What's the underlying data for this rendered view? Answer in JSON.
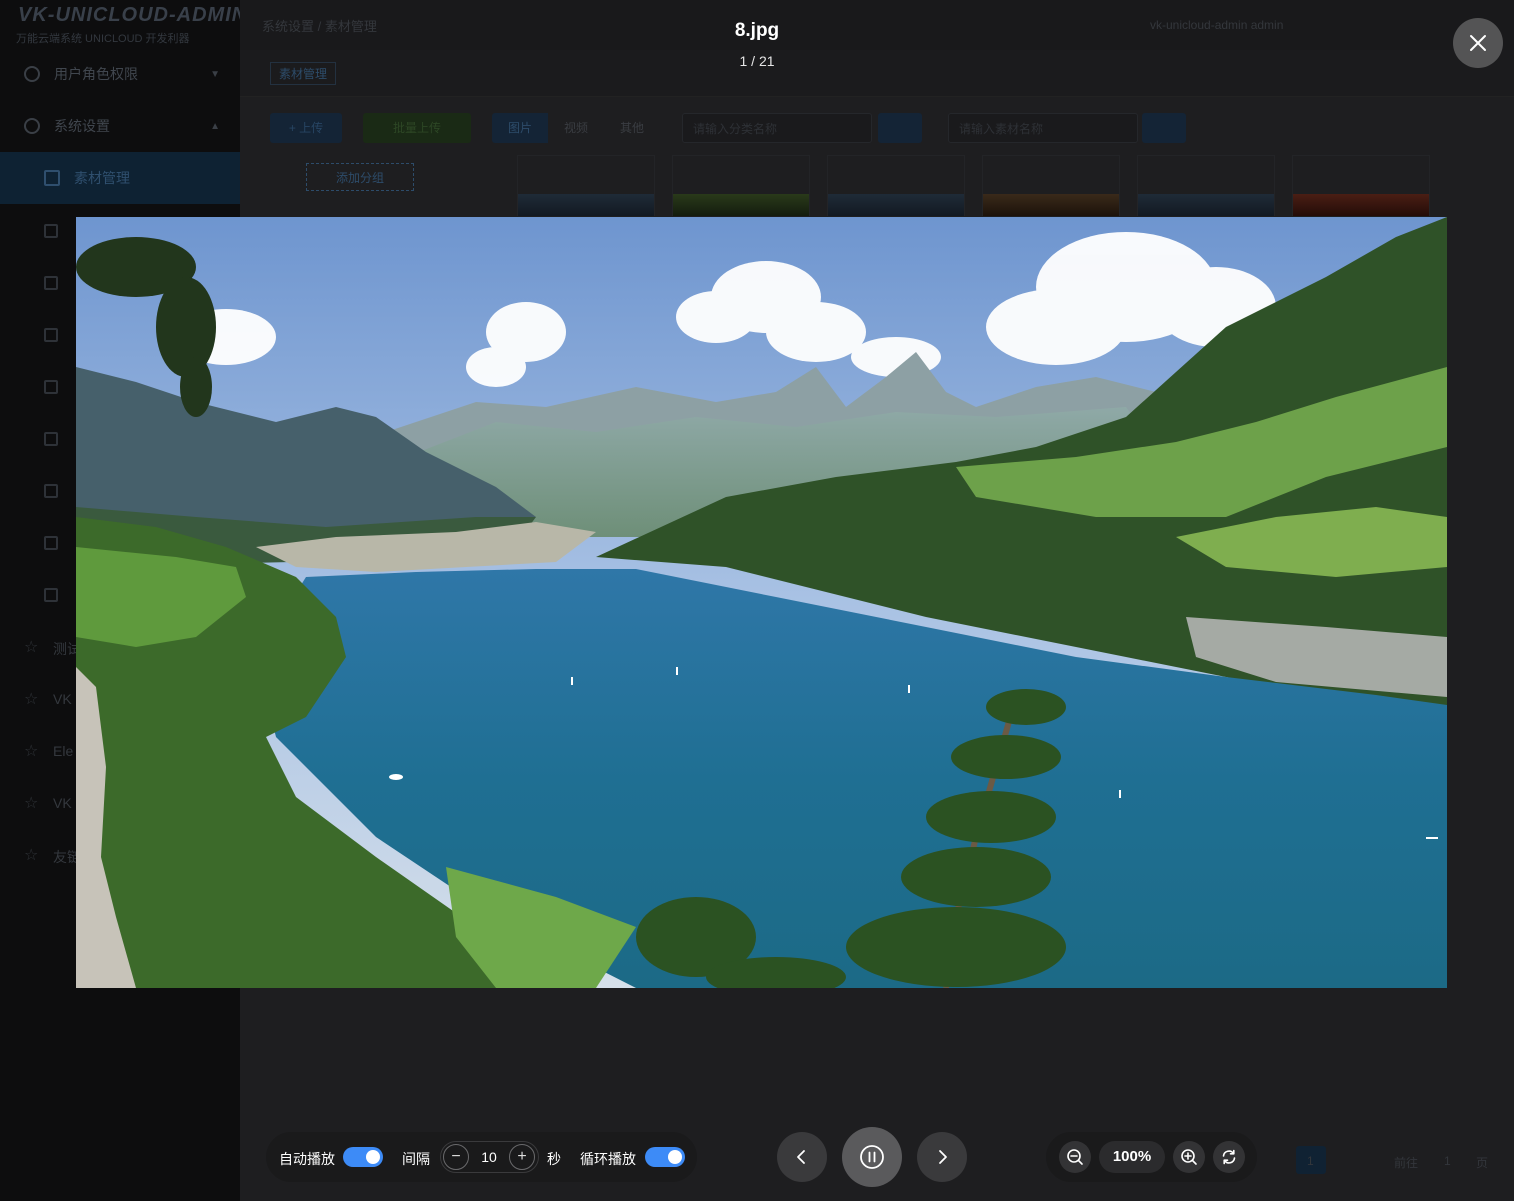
{
  "background_app": {
    "brand_title": "VK-UNICLOUD-ADMIN",
    "brand_subtitle": "万能云端系统 UNICLOUD 开发利器",
    "sidebar": [
      {
        "label": "用户角色权限"
      },
      {
        "label": "系统设置"
      },
      {
        "label": "素材管理"
      }
    ],
    "sidebar_bottom": [
      "测试",
      "VK",
      "Ele",
      "VK",
      "友链"
    ],
    "breadcrumb": "系统设置 / 素材管理",
    "user_info": "vk-unicloud-admin  admin",
    "tab_label": "素材管理",
    "upload_label": "+ 上传",
    "batch_label": "批量上传",
    "filters": [
      "图片",
      "视频",
      "其他"
    ],
    "search_placeholder_1": "请输入分类名称",
    "search_placeholder_2": "请输入素材名称",
    "add_group_label": "添加分组",
    "pager": [
      "1",
      "前往",
      "1",
      "页"
    ]
  },
  "viewer": {
    "file_name": "8.jpg",
    "counter": "1 / 21",
    "close_icon": "close-icon",
    "autoplay_label": "自动播放",
    "autoplay_on": true,
    "interval_label": "间隔",
    "interval_value": "10",
    "seconds_label": "秒",
    "loop_label": "循环播放",
    "loop_on": true,
    "zoom_value": "100%",
    "accent_color": "#3d8bf7"
  }
}
